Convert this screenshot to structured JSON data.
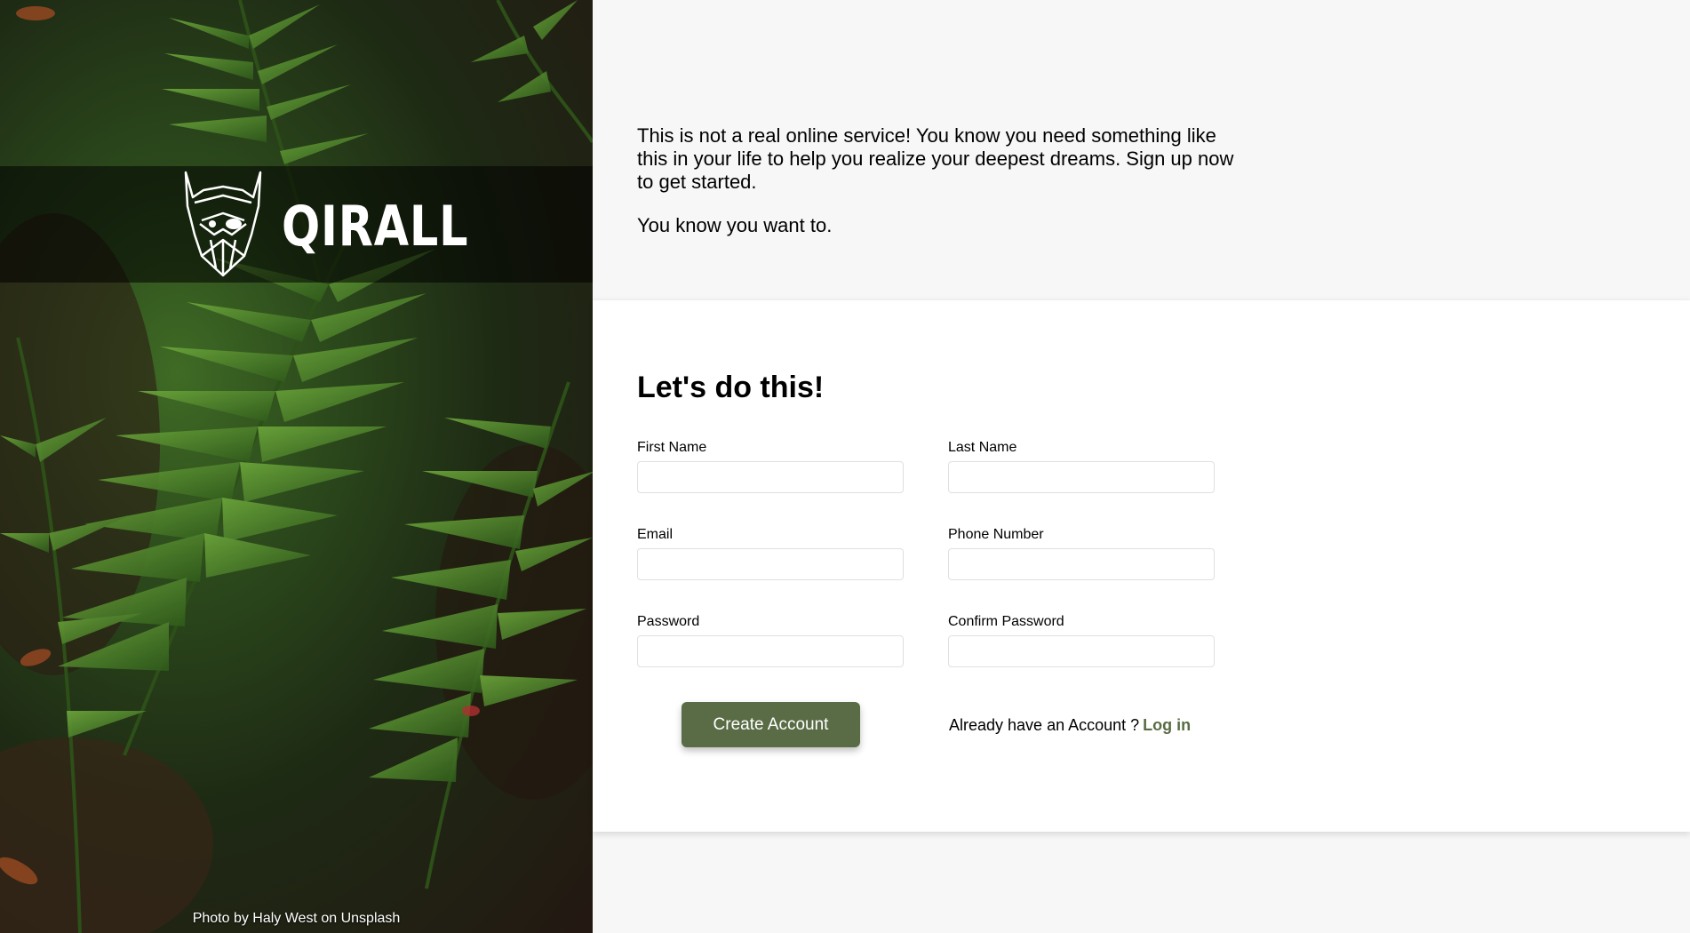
{
  "brand": {
    "name": "QIRALL",
    "logo_icon": "viking-helmet-icon"
  },
  "photo_credit": "Photo by Haly West on Unsplash",
  "intro": {
    "paragraph1": "This is not a real online service! You know you need something like this in your life to help you realize your deepest dreams. Sign up now to get started.",
    "paragraph2": "You know you want to."
  },
  "form": {
    "title": "Let's do this!",
    "fields": {
      "first_name": {
        "label": "First Name",
        "value": ""
      },
      "last_name": {
        "label": "Last Name",
        "value": ""
      },
      "email": {
        "label": "Email",
        "value": ""
      },
      "phone": {
        "label": "Phone Number",
        "value": ""
      },
      "password": {
        "label": "Password",
        "value": ""
      },
      "confirm_password": {
        "label": "Confirm Password",
        "value": ""
      }
    },
    "submit_label": "Create Account",
    "login_prompt": "Already have an Account ?",
    "login_link": "Log in"
  },
  "colors": {
    "accent": "#596c45",
    "page_bg": "#f7f7f7",
    "card_bg": "#ffffff"
  }
}
